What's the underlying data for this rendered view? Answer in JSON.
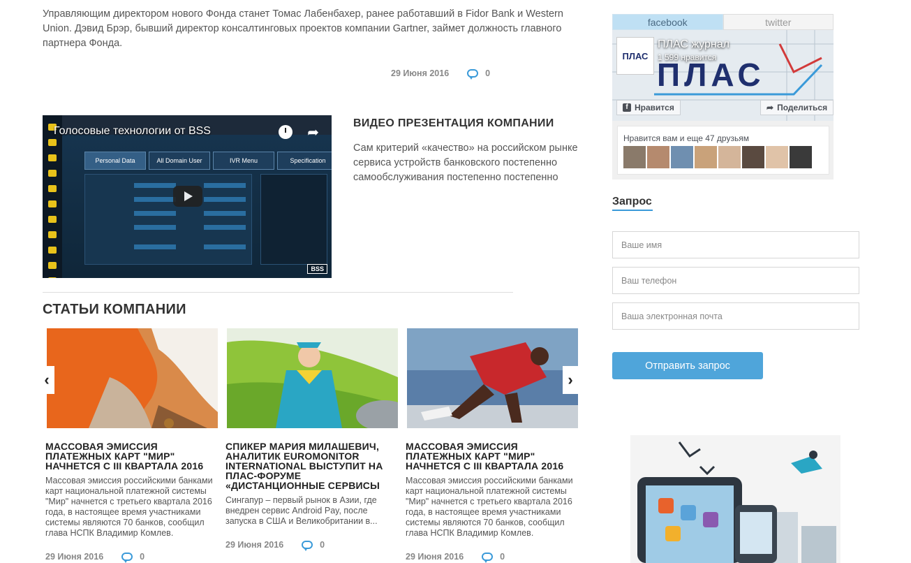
{
  "lead": {
    "text": "Управляющим директором нового Фонда станет Томас Лабенбахер, ранее работавший в Fidor Bank и Western Union. Дэвид Брэр, бывший директор консалтинговых проектов компании Gartner, займет должность главного партнера Фонда.",
    "date": "29 Июня 2016",
    "comments": "0"
  },
  "video": {
    "title": "Голосовые технологии от BSS",
    "tabs": [
      "Personal Data",
      "All Domain User",
      "IVR Menu",
      "Specification"
    ],
    "watermark": "BSS",
    "heading": "ВИДЕО ПРЕЗЕНТАЦИЯ КОМПАНИИ",
    "description": "Сам критерий «качество» на российском рынке сервиса устройств банковского постепенно самообслуживания постепенно постепенно"
  },
  "articles": {
    "section_title": "СТАТЬИ КОМПАНИИ",
    "prev_arrow": "‹",
    "next_arrow": "›",
    "items": [
      {
        "title": "МАССОВАЯ ЭМИССИЯ ПЛАТЕЖНЫХ КАРТ \"МИР\" НАЧНЕТСЯ С III КВАРТАЛА 2016",
        "excerpt": "Массовая эмиссия российскими банками карт национальной платежной системы \"Мир\" начнется с третьего квартала 2016 года, в настоящее время участниками системы являются 70 банков, сообщил глава НСПК Владимир Комлев.",
        "date": "29 Июня 2016",
        "comments": "0"
      },
      {
        "title": "СПИКЕР МАРИЯ МИЛАШЕВИЧ, АНАЛИТИК EUROMONITOR INTERNATIONAL ВЫСТУПИТ НА ПЛАС-ФОРУМЕ «ДИСТАНЦИОННЫЕ СЕРВИСЫ",
        "excerpt": "Сингапур – первый рынок в Азии, где внедрен сервис Android Pay, после запуска в США и Великобритании в...",
        "date": "29 Июня 2016",
        "comments": "0"
      },
      {
        "title": "МАССОВАЯ ЭМИССИЯ ПЛАТЕЖНЫХ КАРТ \"МИР\" НАЧНЕТСЯ С III КВАРТАЛА 2016",
        "excerpt": "Массовая эмиссия российскими банками карт национальной платежной системы \"Мир\" начнется с третьего квартала 2016 года, в настоящее время участниками системы являются 70 банков, сообщил глава НСПК Владимир Комлев.",
        "date": "29 Июня 2016",
        "comments": "0"
      }
    ]
  },
  "social": {
    "tab_facebook": "facebook",
    "tab_twitter": "twitter",
    "page_name": "ПЛАС журнал",
    "likes": "1 599 нравится",
    "like_button": "Нравится",
    "share_button": "Поделиться",
    "friends_text": "Нравится вам и еще 47 друзьям",
    "logo_text": "ПЛАС"
  },
  "request_form": {
    "title": "Запрос",
    "name_placeholder": "Ваше имя",
    "phone_placeholder": "Ваш телефон",
    "email_placeholder": "Ваша электронная почта",
    "submit_label": "Отправить запрос"
  },
  "colors": {
    "accent": "#4fa5da",
    "facebook_tab": "#bfe0f4"
  }
}
